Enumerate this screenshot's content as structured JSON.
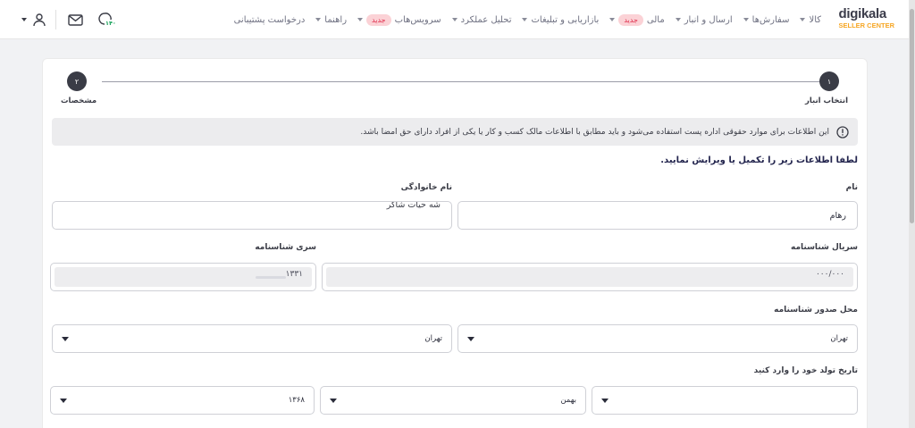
{
  "brand": {
    "word": "digikala",
    "sub": "SELLER CENTER"
  },
  "nav": [
    {
      "label": "کالا",
      "caret": true
    },
    {
      "label": "سفارش‌ها",
      "caret": true
    },
    {
      "label": "ارسال و انبار",
      "caret": true
    },
    {
      "label": "مالی",
      "caret": true,
      "badge": "جدید"
    },
    {
      "label": "بازاریابی و تبلیغات",
      "caret": true
    },
    {
      "label": "تحلیل عملکرد",
      "caret": true
    },
    {
      "label": "سرویس‌هاب",
      "caret": true,
      "badge": "جدید"
    },
    {
      "label": "راهنما",
      "caret": true
    },
    {
      "label": "درخواست پشتیبانی",
      "caret": false
    }
  ],
  "header_icons": {
    "support_badge": "۱۴۰",
    "colors": {
      "accent": "#f6a623",
      "badge_bg": "#fbd2d6",
      "badge_text": "#e0304e",
      "support_green": "#19a35b"
    }
  },
  "stepper": {
    "step1": {
      "number": "۱",
      "label": "انتخاب انبار"
    },
    "step2": {
      "number": "۲",
      "label": "مشخصات"
    }
  },
  "info": {
    "text": "این اطلاعات برای موارد حقوقی اداره پست استفاده می‌شود و باید مطابق با اطلاعات مالک کسب و کار یا یکی از افراد دارای حق امضا باشد."
  },
  "form": {
    "intro": "لطفا اطلاعات زیر را تکمیل یا ویرایش نمایید.",
    "first_name": {
      "label": "نام",
      "value": "رهام"
    },
    "last_name": {
      "label": "نام خانوادگی",
      "value": "شه حیات شاکر"
    },
    "serial": {
      "label": "سریال شناسنامه",
      "value": "۰۰۰/۰۰۰"
    },
    "series": {
      "label": "سری شناسنامه",
      "value": "۱۳۳۱"
    },
    "issue_place": {
      "label": "محل صدور شناسنامه",
      "value1": "تهران",
      "value2": "تهران"
    },
    "birth": {
      "label": "تاریخ تولد خود را وارد کنید",
      "day": "",
      "month": "بهمن",
      "year": "۱۳۶۸"
    }
  }
}
